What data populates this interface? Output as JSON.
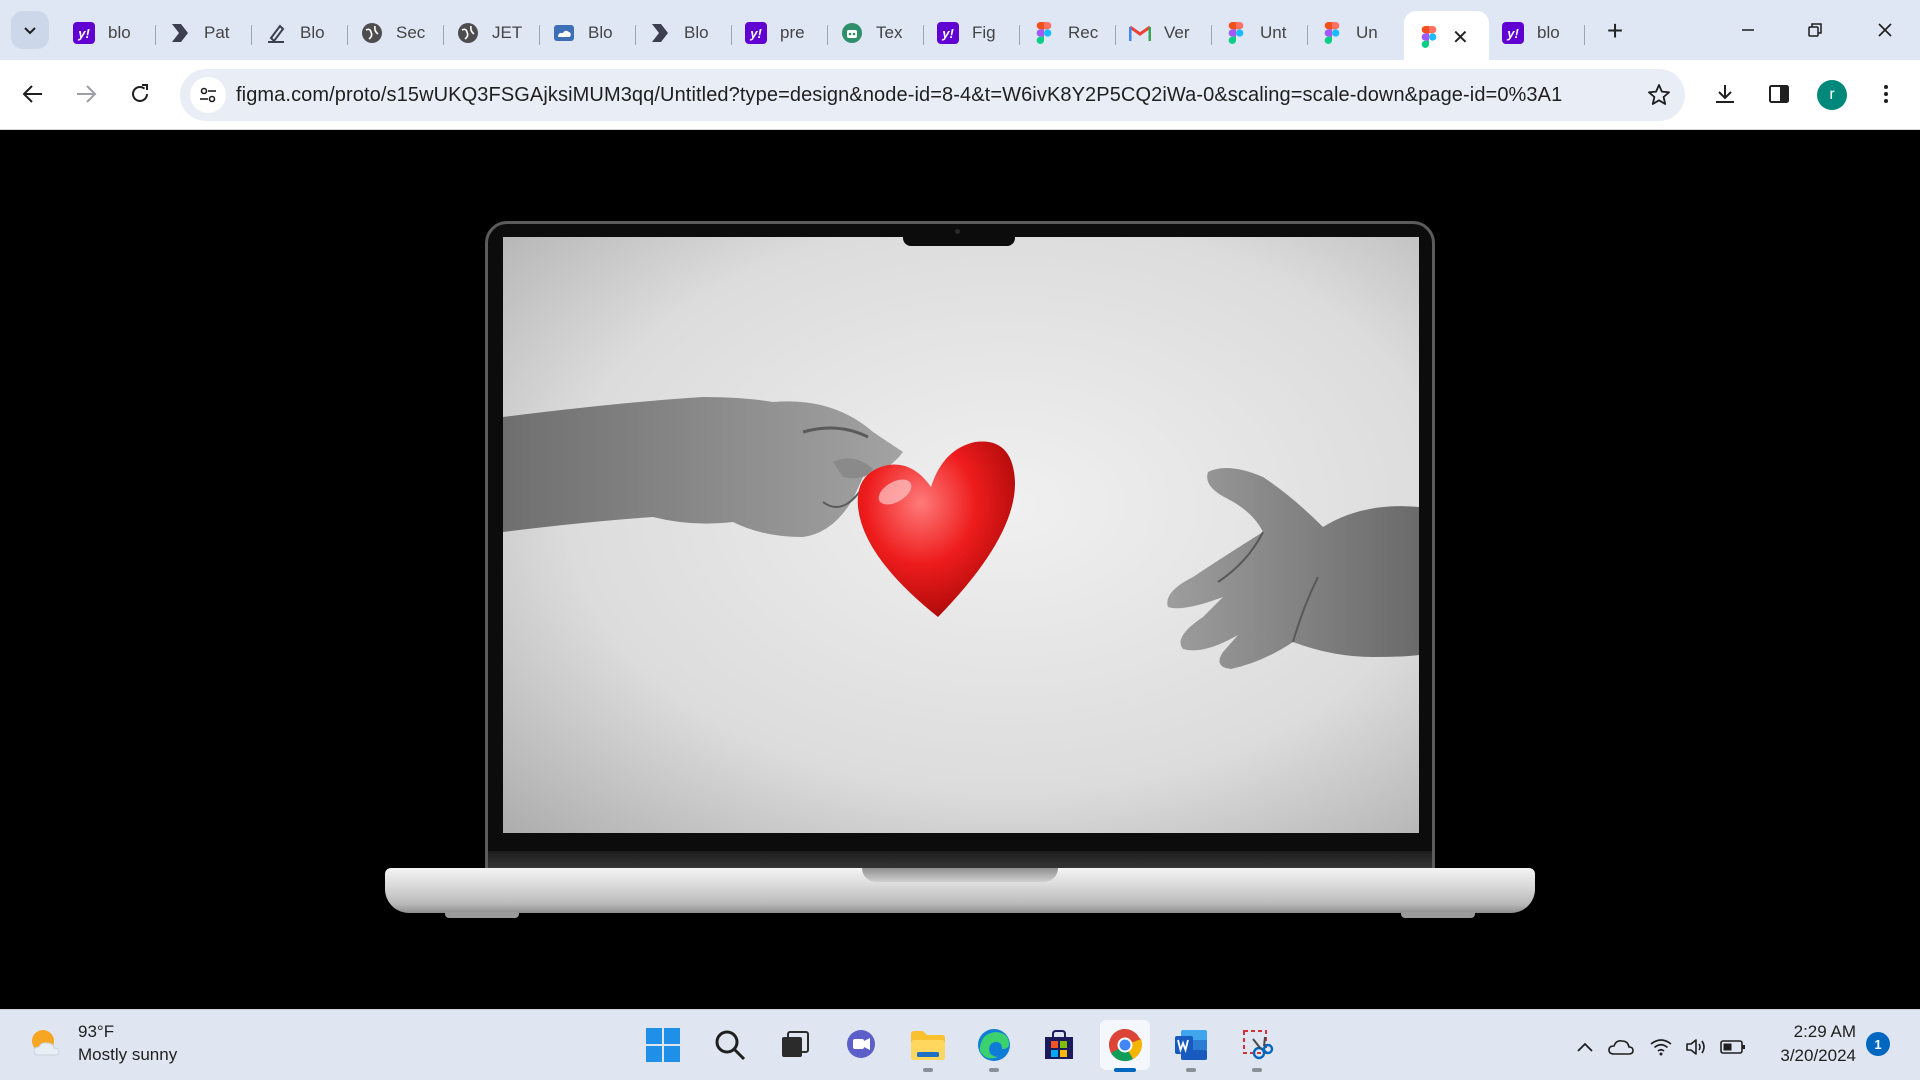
{
  "browser": {
    "tabs": [
      {
        "favicon": "yahoo-icon",
        "title": "blo"
      },
      {
        "favicon": "chevron-brand-icon",
        "title": "Pat"
      },
      {
        "favicon": "blog-pen-icon",
        "title": "Blo"
      },
      {
        "favicon": "globe-icon",
        "title": "Sec"
      },
      {
        "favicon": "globe-icon",
        "title": "JET"
      },
      {
        "favicon": "cloud-icon",
        "title": "Blo"
      },
      {
        "favicon": "chevron-brand-icon",
        "title": "Blo"
      },
      {
        "favicon": "yahoo-icon",
        "title": "pre"
      },
      {
        "favicon": "robot-icon",
        "title": "Tex"
      },
      {
        "favicon": "yahoo-icon",
        "title": "Fig"
      },
      {
        "favicon": "figma-icon",
        "title": "Rec"
      },
      {
        "favicon": "gmail-icon",
        "title": "Ver"
      },
      {
        "favicon": "figma-icon",
        "title": "Unt"
      },
      {
        "favicon": "figma-icon",
        "title": "Un"
      },
      {
        "favicon": "figma-icon",
        "title": "",
        "active": true
      },
      {
        "favicon": "yahoo-icon",
        "title": "blo"
      }
    ],
    "close_symbol": "✕",
    "new_tab_symbol": "+",
    "url": "figma.com/proto/s15wUKQ3FSGAjksiMUM3qq/Untitled?type=design&node-id=8-4&t=W6ivK8Y2P5CQ2iWa-0&scaling=scale-down&page-id=0%3A1",
    "profile_initial": "r"
  },
  "taskbar": {
    "weather": {
      "temp": "93°F",
      "condition": "Mostly sunny"
    },
    "apps": [
      "start",
      "search",
      "task-view",
      "teams",
      "file-explorer",
      "edge",
      "store",
      "chrome",
      "word",
      "snipping-tool"
    ],
    "clock": {
      "time": "2:29 AM",
      "date": "3/20/2024"
    },
    "notification_count": "1"
  }
}
